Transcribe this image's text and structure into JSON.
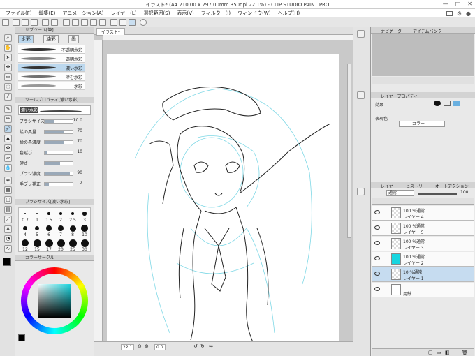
{
  "window": {
    "title": "イラスト* (A4 210.00 x 297.00mm 350dpi 22.1%) - CLIP STUDIO PAINT PRO",
    "controls": [
      "—",
      "□",
      "✕"
    ]
  },
  "menu": [
    "ファイル(F)",
    "編集(E)",
    "アニメーション(A)",
    "レイヤー(L)",
    "選択範囲(S)",
    "表示(V)",
    "フィルター(I)",
    "ウィンドウ(W)",
    "ヘルプ(H)"
  ],
  "canvas": {
    "tab": "イラスト*",
    "zoom": "22.1",
    "angle": "0.0"
  },
  "subtool_panel": {
    "title": "サブツール[筆]",
    "tabs": [
      "水彩",
      "油彩",
      "墨"
    ],
    "items": [
      "不透明水彩",
      "透明水彩",
      "濃い水彩",
      "滲む水彩",
      "水彩"
    ],
    "selected_index": 2
  },
  "tool_property": {
    "title": "ツールプロパティ[濃い水彩]",
    "brush_name": "濃い水彩",
    "props": [
      {
        "label": "ブラシサイズ",
        "value": "10.0",
        "fill": 0.35
      },
      {
        "label": "絵の具量",
        "value": "70",
        "fill": 0.7
      },
      {
        "label": "絵の具濃度",
        "value": "70",
        "fill": 0.7
      },
      {
        "label": "色延び",
        "value": "10",
        "fill": 0.1
      },
      {
        "label": "硬さ",
        "value": "",
        "fill": 0.55
      },
      {
        "label": "ブラシ濃度",
        "value": "90",
        "fill": 0.9
      },
      {
        "label": "手ブレ補正",
        "value": "2",
        "fill": 0.15
      }
    ]
  },
  "brush_size_panel": {
    "title": "ブラシサイズ[濃い水彩]",
    "sizes": [
      "0.7",
      "1",
      "1.5",
      "2",
      "2.5",
      "3",
      "4",
      "5",
      "6",
      "7",
      "8",
      "10",
      "12",
      "15",
      "17",
      "20",
      "25",
      "30"
    ]
  },
  "color_panel": {
    "title": "カラーサークル",
    "main_color": "#18d6e0",
    "sub_color": "#ffffff"
  },
  "navigator": {
    "tabs": [
      "ナビゲーター",
      "アイテムバンク"
    ]
  },
  "layer_property": {
    "title": "レイヤープロパティ",
    "effect_label": "効果",
    "expression_label": "表現色",
    "expression_value": "カラー"
  },
  "layer_panel": {
    "tabs": [
      "レイヤー",
      "ヒストリー",
      "オートアクション"
    ],
    "blend_mode": "通常",
    "opacity": "100",
    "layers": [
      {
        "mode": "100 %通常",
        "name": "レイヤー 4",
        "thumb": "checker",
        "visible": true,
        "selected": false
      },
      {
        "mode": "100 %通常",
        "name": "レイヤー 5",
        "thumb": "checker",
        "visible": true,
        "selected": false
      },
      {
        "mode": "100 %通常",
        "name": "レイヤー 3",
        "thumb": "checker",
        "visible": true,
        "selected": false
      },
      {
        "mode": "100 %通常",
        "name": "レイヤー 2",
        "thumb": "#18d6e0",
        "visible": true,
        "selected": false
      },
      {
        "mode": "10 %通常",
        "name": "レイヤー 1",
        "thumb": "checker",
        "visible": true,
        "selected": true
      },
      {
        "mode": "",
        "name": "用紙",
        "thumb": "#ffffff",
        "visible": true,
        "selected": false
      }
    ]
  }
}
